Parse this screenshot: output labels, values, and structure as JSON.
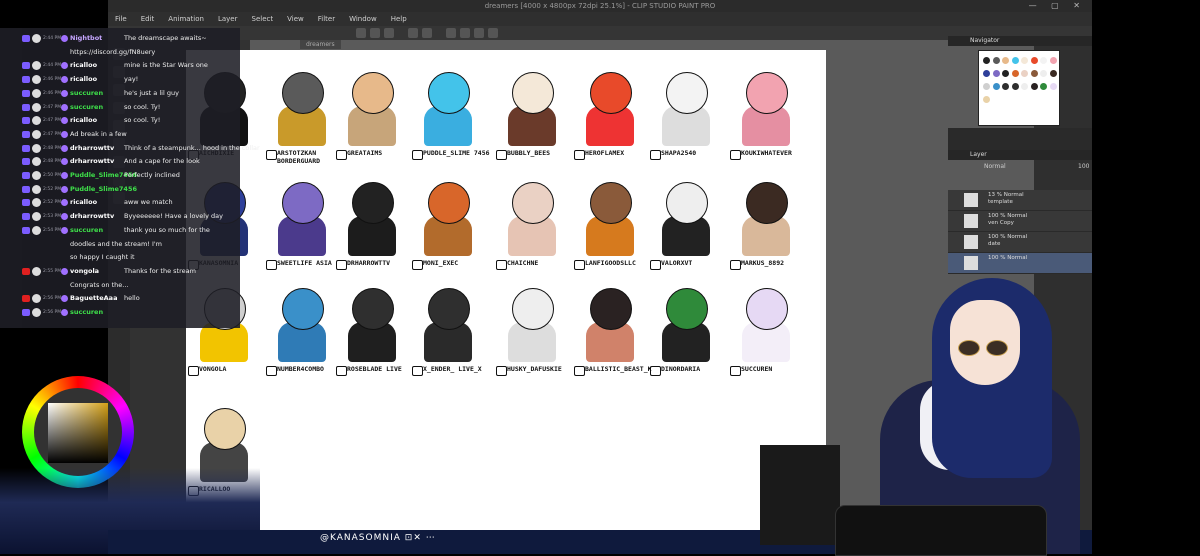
{
  "window": {
    "title": "dreamers [4000 x 4800px 72dpi 25.1%] - CLIP STUDIO PAINT PRO",
    "controls": "— ▢ ✕"
  },
  "menu": [
    "File",
    "Edit",
    "Animation",
    "Layer",
    "Select",
    "View",
    "Filter",
    "Window",
    "Help"
  ],
  "doc_tab": "dreamers",
  "panels": {
    "navigator": "Navigator",
    "layer": "Layer",
    "blend": "Normal",
    "opacity": "100"
  },
  "layers": [
    {
      "label": "13 % Normal",
      "name": "template"
    },
    {
      "label": "100 % Normal",
      "name": "ven Copy"
    },
    {
      "label": "100 % Normal",
      "name": "date"
    },
    {
      "label": "100 % Normal",
      "name": ""
    }
  ],
  "chat": [
    {
      "time": "2:44 PM",
      "user": "Nightbot",
      "text": "The dreamscape awaits~",
      "user_color": "#c6a6ff",
      "icon": "#7b5cff"
    },
    {
      "time": "",
      "user": "",
      "text": "https://discord.gg/fN8uery",
      "user_color": "#fff",
      "icon": ""
    },
    {
      "time": "2:44 PM",
      "user": "ricalloo",
      "text": "mine is the Star Wars one",
      "user_color": "#fff",
      "icon": "#7b5cff"
    },
    {
      "time": "2:46 PM",
      "user": "ricalloo",
      "text": "yay!",
      "user_color": "#fff",
      "icon": "#7b5cff"
    },
    {
      "time": "2:46 PM",
      "user": "succuren",
      "text": "he's just a lil guy",
      "user_color": "#3ee04a",
      "icon": "#7b5cff"
    },
    {
      "time": "2:47 PM",
      "user": "succuren",
      "text": "so cool. Ty!",
      "user_color": "#3ee04a",
      "icon": "#7b5cff"
    },
    {
      "time": "2:47 PM",
      "user": "ricalloo",
      "text": "so cool. Ty!",
      "user_color": "#fff",
      "icon": "#7b5cff"
    },
    {
      "time": "2:47 PM",
      "user": "",
      "text": "Ad break in a few",
      "user_color": "#fff",
      "icon": "#7b5cff"
    },
    {
      "time": "2:48 PM",
      "user": "drharrowttv",
      "text": "Think of a steampunk... hood in the collar",
      "user_color": "#fff",
      "icon": "#7b5cff"
    },
    {
      "time": "2:48 PM",
      "user": "drharrowttv",
      "text": "And a cape for the look",
      "user_color": "#fff",
      "icon": "#7b5cff"
    },
    {
      "time": "2:50 PM",
      "user": "Puddle_Slime7456",
      "text": "Perfectly inclined",
      "user_color": "#3ee04a",
      "icon": "#7b5cff"
    },
    {
      "time": "2:52 PM",
      "user": "Puddle_Slime7456",
      "text": "",
      "user_color": "#3ee04a",
      "icon": "#7b5cff"
    },
    {
      "time": "2:52 PM",
      "user": "ricalloo",
      "text": "aww we match",
      "user_color": "#fff",
      "icon": "#7b5cff"
    },
    {
      "time": "2:53 PM",
      "user": "drharrowttv",
      "text": "Byyeeeeee! Have a lovely day",
      "user_color": "#fff",
      "icon": "#7b5cff"
    },
    {
      "time": "2:54 PM",
      "user": "succuren",
      "text": "thank you so much for the",
      "user_color": "#3ee04a",
      "icon": "#7b5cff"
    },
    {
      "time": "",
      "user": "",
      "text": "doodles and the stream! I'm",
      "user_color": "#fff",
      "icon": ""
    },
    {
      "time": "",
      "user": "",
      "text": "so happy I caught it",
      "user_color": "#fff",
      "icon": ""
    },
    {
      "time": "2:55 PM",
      "user": "vongola",
      "text": "Thanks for the stream",
      "user_color": "#fff",
      "icon": "#e02020"
    },
    {
      "time": "",
      "user": "",
      "text": "Congrats on the... ",
      "user_color": "#fff",
      "icon": ""
    },
    {
      "time": "2:56 PM",
      "user": "BaguetteAaa",
      "text": "hello",
      "user_color": "#fff",
      "icon": "#e02020"
    },
    {
      "time": "2:56 PM",
      "user": "succuren",
      "text": "",
      "user_color": "#3ee04a",
      "icon": "#7b5cff"
    }
  ],
  "grid": [
    {
      "name": "AICHDIXIE",
      "head": "#222",
      "body": "#111",
      "platform": "twitch"
    },
    {
      "name": "ARSTOTZKAN BORDERGUARD",
      "head": "#5a5a5a",
      "body": "#c99a2a",
      "platform": "twitch"
    },
    {
      "name": "GREATAIMS",
      "head": "#e7b98a",
      "body": "#c7a57a",
      "platform": "twitch"
    },
    {
      "name": "PUDDLE_SLIME 7456",
      "head": "#43c3ea",
      "body": "#3aaee0",
      "platform": "twitch"
    },
    {
      "name": "BUBBLY_BEES",
      "head": "#f4e8d8",
      "body": "#6a3a2a",
      "platform": "twitch"
    },
    {
      "name": "HEROFLAMEX",
      "head": "#e84a2a",
      "body": "#e33",
      "platform": "twitch"
    },
    {
      "name": "SHAPA2540",
      "head": "#f3f3f3",
      "body": "#ddd",
      "platform": "twitch"
    },
    {
      "name": "KOUKIWHATEVER",
      "head": "#f2a3b0",
      "body": "#e58fa2",
      "platform": "twitch"
    },
    {
      "name": "KANASOMNIA",
      "head": "#2e3f9a",
      "body": "#233276",
      "platform": "twitch"
    },
    {
      "name": "SWEETLIFE ASIA",
      "head": "#7d6ac4",
      "body": "#4b3a8c",
      "platform": "twitch"
    },
    {
      "name": "DRHARROWTTV",
      "head": "#222",
      "body": "#1c1c1c",
      "platform": "twitch"
    },
    {
      "name": "MONI_EXEC",
      "head": "#d8662a",
      "body": "#b26b2c",
      "platform": "twitch"
    },
    {
      "name": "CHAICHNE",
      "head": "#ead1c4",
      "body": "#e6c4b4",
      "platform": "twitch"
    },
    {
      "name": "LANFIGOODSLLC",
      "head": "#8a5a3a",
      "body": "#d67a1e",
      "platform": "twitch"
    },
    {
      "name": "VALORXVT",
      "head": "#eeeeee",
      "body": "#222",
      "platform": "twitch"
    },
    {
      "name": "MARKUS_8892",
      "head": "#3b2a22",
      "body": "#d9b89a",
      "platform": "twitch"
    },
    {
      "name": "VONGOLA",
      "head": "#cfcfcf",
      "body": "#f2c400",
      "platform": "youtube"
    },
    {
      "name": "NUMBER4COMBO",
      "head": "#3a90c9",
      "body": "#2f7bb6",
      "platform": "twitch"
    },
    {
      "name": "ROSEBLADE LIVE",
      "head": "#2f2f2f",
      "body": "#1f1f1f",
      "platform": "twitch"
    },
    {
      "name": "X_ENDER_ LIVE_X",
      "head": "#2f2f2f",
      "body": "#2a2a2a",
      "platform": "twitch"
    },
    {
      "name": "HUSKY_DAFUSKIE",
      "head": "#eeeeee",
      "body": "#ddd",
      "platform": "twitch"
    },
    {
      "name": "BALLISTIC_BEAST_K",
      "head": "#2a2222",
      "body": "#d0826a",
      "platform": "twitch"
    },
    {
      "name": "DINORDARIA",
      "head": "#2f8a3a",
      "body": "#222",
      "platform": "twitch"
    },
    {
      "name": "SUCCUREN",
      "head": "#e6d9f4",
      "body": "#f3eef8",
      "platform": "twitch"
    },
    {
      "name": "RICALLOO",
      "head": "#e9d2a8",
      "body": "#444",
      "platform": "twitch"
    }
  ],
  "banner": {
    "handle": "@KANASOMNIA",
    "icons": "⊡✕ ⋯"
  }
}
